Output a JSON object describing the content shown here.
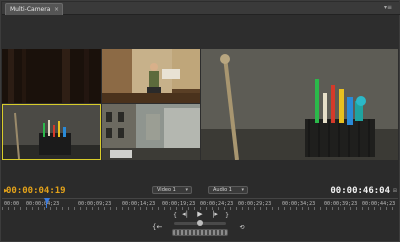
{
  "panel": {
    "tab_label": "Multi-Camera",
    "close_glyph": "×",
    "menu_glyph": "▾≡"
  },
  "viewer": {
    "cameras": [
      {
        "name": "camera-1",
        "scene": "dark stage"
      },
      {
        "name": "camera-2",
        "scene": "performer on stage"
      },
      {
        "name": "camera-3",
        "scene": "pencil cup close-up",
        "selected": true
      },
      {
        "name": "camera-4",
        "scene": "street scene"
      }
    ],
    "program_scene": "pencil cup close-up"
  },
  "timecode": {
    "current": "00:00:04:19",
    "duration": "00:00:46:04"
  },
  "dropdowns": {
    "video": "Video 1",
    "audio": "Audio 1"
  },
  "ruler": {
    "labels": [
      "00:00",
      "00:00;09;23",
      "00:00;14;23",
      "00:00;19;23",
      "00:00;24;23",
      "00:00;29;23",
      "00:00;34;23",
      "00:00;39;23",
      "00:00;44;23"
    ],
    "first_label": "00:00;04;23"
  },
  "transport": {
    "mark_in": "{",
    "mark_out": "}",
    "go_in": "{←",
    "step_back": "◂|",
    "play": "▶",
    "step_forward": "|▸",
    "go_out": "→}",
    "loop": "⟲",
    "record": "●"
  },
  "colors": {
    "accent_timecode": "#e3a21a",
    "selected_camera_border": "#d8cc2a",
    "playhead": "#3a7be0"
  }
}
